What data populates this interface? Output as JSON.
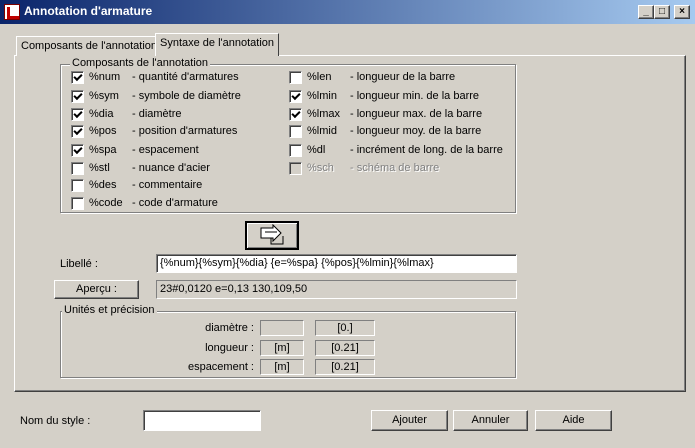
{
  "window": {
    "title": "Annotation d'armature",
    "controls": {
      "minimize": "_",
      "maximize": "□",
      "close": "×"
    }
  },
  "tabs": [
    {
      "label": "Composants de l'annotation",
      "active": false
    },
    {
      "label": "Syntaxe de l'annotation",
      "active": true
    }
  ],
  "components": {
    "group_title": "Composants de l'annotation",
    "left": [
      {
        "code": "%num",
        "desc": "- quantité d'armatures",
        "checked": true
      },
      {
        "code": "%sym",
        "desc": "- symbole de diamètre",
        "checked": true
      },
      {
        "code": "%dia",
        "desc": "- diamètre",
        "checked": true
      },
      {
        "code": "%pos",
        "desc": "- position d'armatures",
        "checked": true
      },
      {
        "code": "%spa",
        "desc": "- espacement",
        "checked": true
      },
      {
        "code": "%stl",
        "desc": "- nuance d'acier",
        "checked": false
      },
      {
        "code": "%des",
        "desc": "- commentaire",
        "checked": false
      },
      {
        "code": "%code",
        "desc": "- code d'armature",
        "checked": false
      }
    ],
    "right": [
      {
        "code": "%len",
        "desc": "- longueur de la barre",
        "checked": false,
        "enabled": true
      },
      {
        "code": "%lmin",
        "desc": "- longueur min. de la barre",
        "checked": true,
        "enabled": true
      },
      {
        "code": "%lmax",
        "desc": "- longueur max. de la barre",
        "checked": true,
        "enabled": true
      },
      {
        "code": "%lmid",
        "desc": "- longueur moy. de la barre",
        "checked": false,
        "enabled": true
      },
      {
        "code": "%dl",
        "desc": "- incrément de long. de la barre",
        "checked": false,
        "enabled": true
      },
      {
        "code": "%sch",
        "desc": "- schéma de barre",
        "checked": false,
        "enabled": false
      }
    ]
  },
  "insert_button_icon": "insert-arrow-icon",
  "libelle": {
    "label": "Libellé :",
    "value": "{%num}{%sym}{%dia} {e=%spa} {%pos}{%lmin}{%lmax}"
  },
  "apercu": {
    "button_label": "Aperçu :",
    "value": "23#0,0120 e=0,13 130,109,50"
  },
  "units": {
    "group_title": "Unités et précision",
    "rows": [
      {
        "label": "diamètre :",
        "unit": "",
        "precision": "[0.]"
      },
      {
        "label": "longueur :",
        "unit": "[m]",
        "precision": "[0.21]"
      },
      {
        "label": "espacement :",
        "unit": "[m]",
        "precision": "[0.21]"
      }
    ]
  },
  "footer": {
    "style_name_label": "Nom du style :",
    "style_name_value": "",
    "buttons": {
      "ok": "Ajouter",
      "cancel": "Annuler",
      "help": "Aide"
    }
  }
}
